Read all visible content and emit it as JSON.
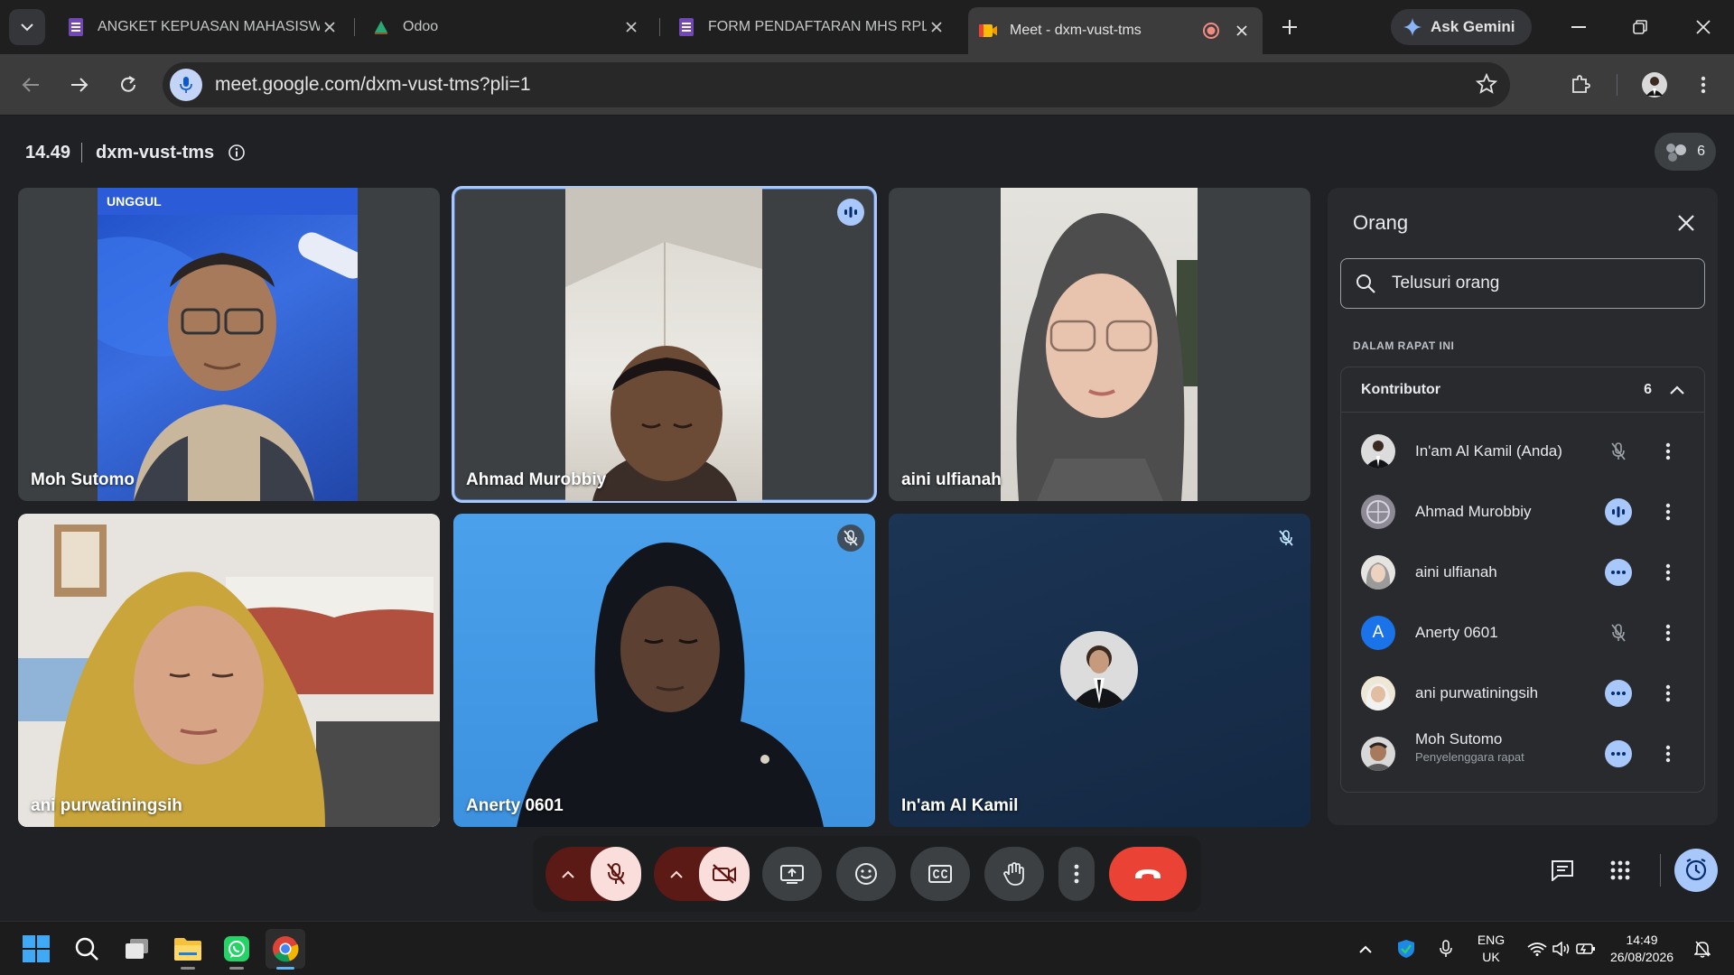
{
  "browser": {
    "tabs": [
      {
        "title": "ANGKET KEPUASAN MAHASISWA",
        "icon": "forms-icon"
      },
      {
        "title": "Odoo",
        "icon": "odoo-icon"
      },
      {
        "title": "FORM PENDAFTARAN MHS RPL - (",
        "icon": "forms-icon"
      },
      {
        "title": "Meet - dxm-vust-tms",
        "icon": "meet-icon",
        "active": true
      }
    ],
    "gemini_label": "Ask Gemini",
    "url": "meet.google.com/dxm-vust-tms?pli=1"
  },
  "meet": {
    "time": "14.49",
    "code": "dxm-vust-tms",
    "participant_count": "6",
    "tiles": [
      {
        "name": "Moh Sutomo"
      },
      {
        "name": "Ahmad Murobbiy"
      },
      {
        "name": "aini ulfianah"
      },
      {
        "name": "ani purwatiningsih"
      },
      {
        "name": "Anerty 0601"
      },
      {
        "name": "In'am Al Kamil"
      }
    ],
    "banner_text": "UNGGUL",
    "panel": {
      "title": "Orang",
      "search_placeholder": "Telusuri orang",
      "section_label": "DALAM RAPAT INI",
      "group_label": "Kontributor",
      "group_count": "6",
      "people": [
        {
          "name": "In'am Al Kamil (Anda)",
          "status": "muted"
        },
        {
          "name": "Ahmad Murobbiy",
          "status": "speaking"
        },
        {
          "name": "aini ulfianah",
          "status": "more"
        },
        {
          "name": "Anerty 0601",
          "status": "muted",
          "initial": "A"
        },
        {
          "name": "ani purwatiningsih",
          "status": "more"
        },
        {
          "name": "Moh Sutomo",
          "role": "Penyelenggara rapat",
          "status": "more"
        }
      ]
    }
  },
  "taskbar": {
    "lang": "ENG",
    "region": "UK",
    "time": "14:49",
    "date": "26/08/2026"
  },
  "colors": {
    "meet_bg": "#202124",
    "hangup": "#ea4335",
    "muted_btn": "#f9dedc",
    "accent": "#a8c7fa"
  }
}
